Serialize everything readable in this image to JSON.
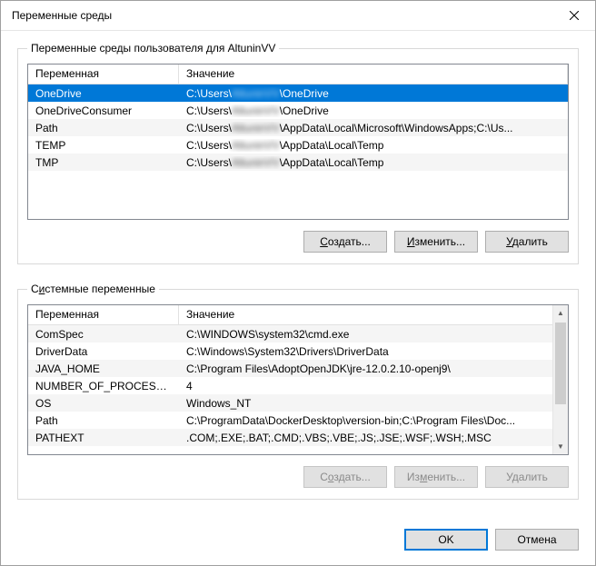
{
  "dialog": {
    "title": "Переменные среды"
  },
  "usergroup": {
    "legend": "Переменные среды пользователя для AltuninVV",
    "header_var": "Переменная",
    "header_val": "Значение",
    "rows": [
      {
        "var": "OneDrive",
        "pre": "C:\\Users\\",
        "mask": "AltuninVV",
        "post": "\\OneDrive",
        "selected": true
      },
      {
        "var": "OneDriveConsumer",
        "pre": "C:\\Users\\",
        "mask": "AltuninVV",
        "post": "\\OneDrive"
      },
      {
        "var": "Path",
        "pre": "C:\\Users\\",
        "mask": "AltuninVV",
        "post": "\\AppData\\Local\\Microsoft\\WindowsApps;C:\\Us..."
      },
      {
        "var": "TEMP",
        "pre": "C:\\Users\\",
        "mask": "AltuninVV",
        "post": "\\AppData\\Local\\Temp"
      },
      {
        "var": "TMP",
        "pre": "C:\\Users\\",
        "mask": "AltuninVV",
        "post": "\\AppData\\Local\\Temp"
      }
    ],
    "buttons": {
      "new": "Создать...",
      "edit": "Изменить...",
      "delete": "Удалить"
    }
  },
  "sysgroup": {
    "legend": "Системные переменные",
    "header_var": "Переменная",
    "header_val": "Значение",
    "rows": [
      {
        "var": "ComSpec",
        "val": "C:\\WINDOWS\\system32\\cmd.exe"
      },
      {
        "var": "DriverData",
        "val": "C:\\Windows\\System32\\Drivers\\DriverData"
      },
      {
        "var": "JAVA_HOME",
        "val": "C:\\Program Files\\AdoptOpenJDK\\jre-12.0.2.10-openj9\\"
      },
      {
        "var": "NUMBER_OF_PROCESSORS",
        "val": "4"
      },
      {
        "var": "OS",
        "val": "Windows_NT"
      },
      {
        "var": "Path",
        "val": "C:\\ProgramData\\DockerDesktop\\version-bin;C:\\Program Files\\Doc..."
      },
      {
        "var": "PATHEXT",
        "val": ".COM;.EXE;.BAT;.CMD;.VBS;.VBE;.JS;.JSE;.WSF;.WSH;.MSC"
      }
    ],
    "buttons": {
      "new": "Создать...",
      "edit": "Изменить...",
      "delete": "Удалить"
    }
  },
  "footer": {
    "ok": "OK",
    "cancel": "Отмена"
  }
}
